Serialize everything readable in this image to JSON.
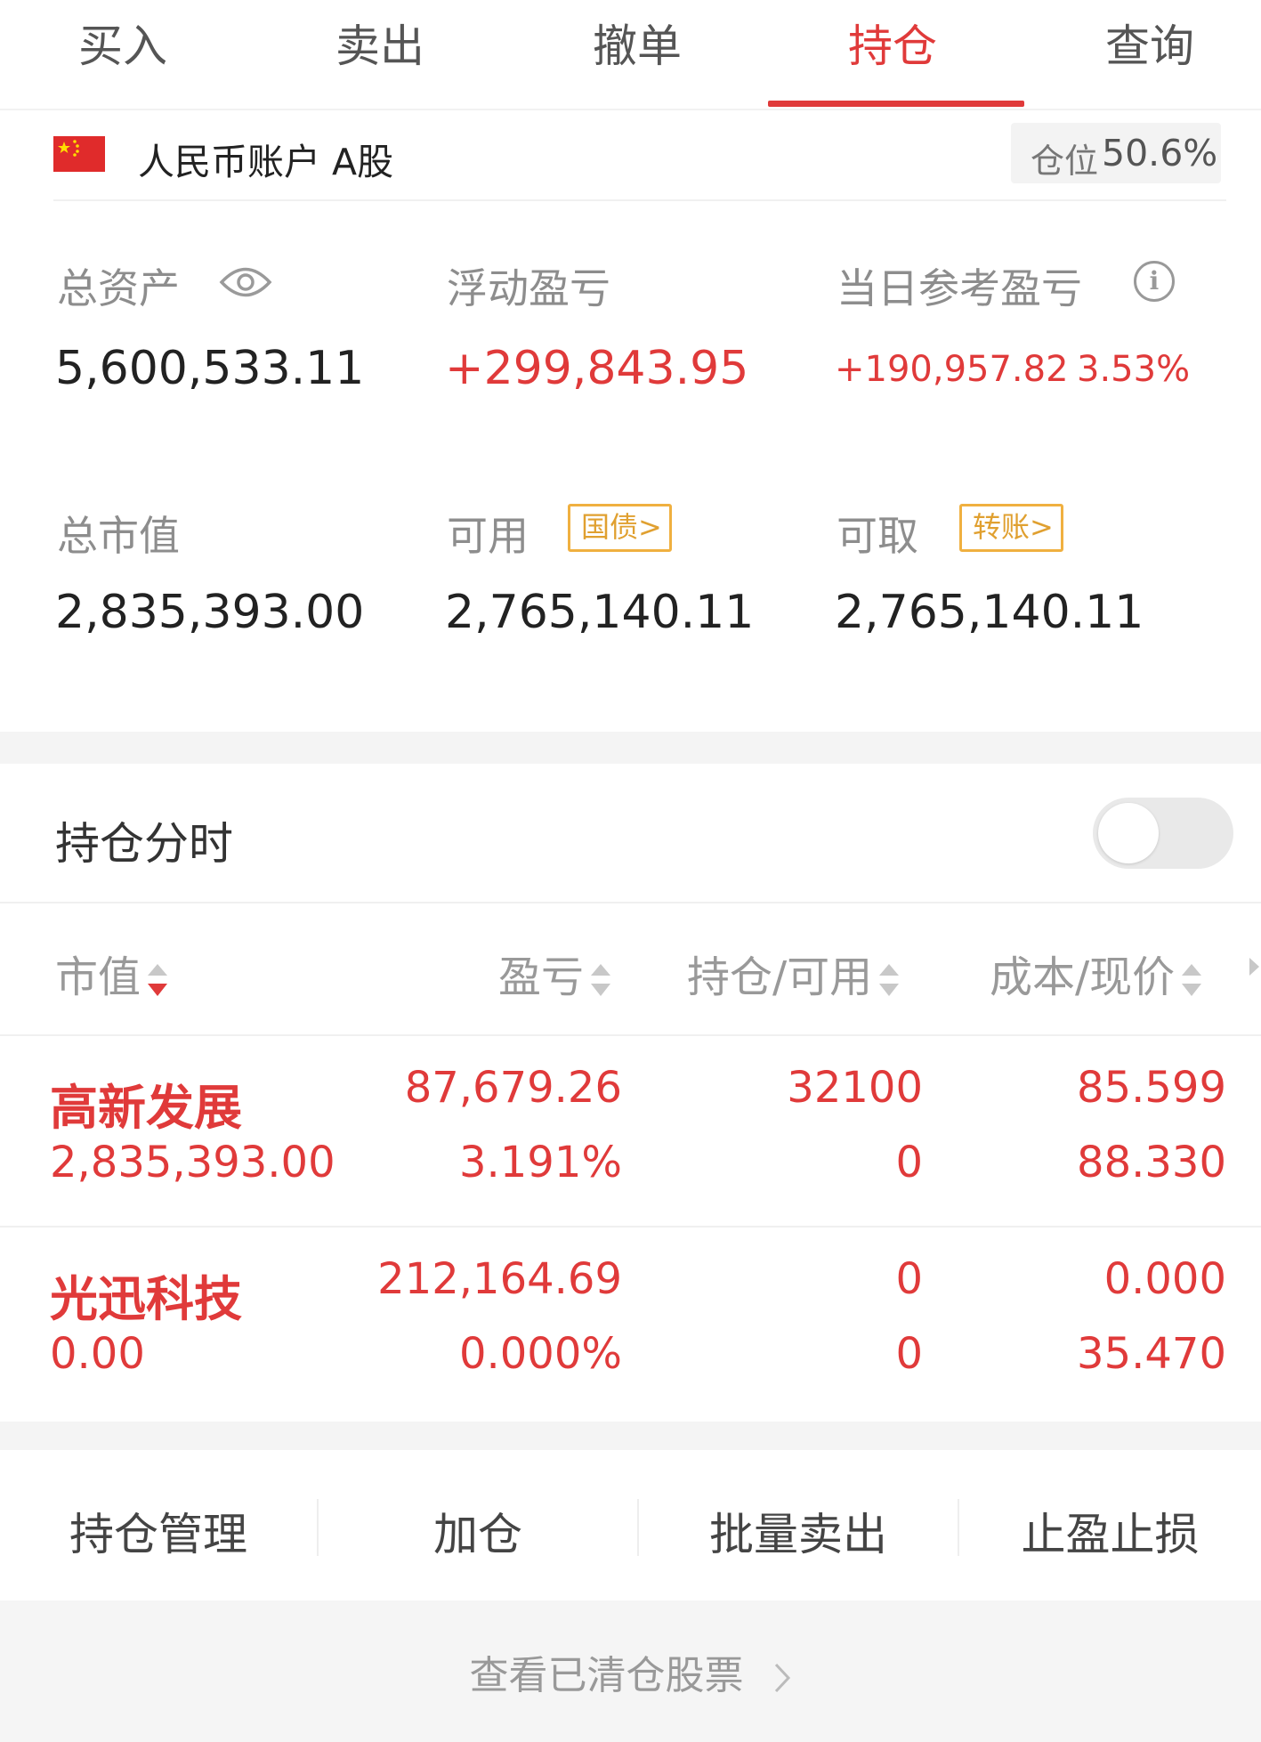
{
  "tabs": [
    {
      "label": "买入"
    },
    {
      "label": "卖出"
    },
    {
      "label": "撤单"
    },
    {
      "label": "持仓",
      "active": true
    },
    {
      "label": "查询"
    }
  ],
  "account": {
    "label": "人民币账户 A股",
    "position_label": "仓位",
    "position_value": "50.6%"
  },
  "summary": {
    "total_assets_label": "总资产",
    "total_assets": "5,600,533.11",
    "floating_pnl_label": "浮动盈亏",
    "floating_pnl": "+299,843.95",
    "daily_pnl_label": "当日参考盈亏",
    "daily_pnl": "+190,957.82",
    "daily_pnl_pct": "3.53%",
    "market_value_label": "总市值",
    "market_value": "2,835,393.00",
    "available_label": "可用",
    "available_tag": "国债>",
    "available": "2,765,140.11",
    "withdrawable_label": "可取",
    "withdrawable_tag": "转账>",
    "withdrawable": "2,765,140.11"
  },
  "timeshare": {
    "label": "持仓分时",
    "toggle_on": false
  },
  "table": {
    "headers": [
      "市值",
      "盈亏",
      "持仓/可用",
      "成本/现价"
    ],
    "rows": [
      {
        "name": "高新发展",
        "market_value": "2,835,393.00",
        "pnl": "87,679.26",
        "pnl_pct": "3.191%",
        "position": "32100",
        "available": "0",
        "cost": "85.599",
        "price": "88.330"
      },
      {
        "name": "光迅科技",
        "market_value": "0.00",
        "pnl": "212,164.69",
        "pnl_pct": "0.000%",
        "position": "0",
        "available": "0",
        "cost": "0.000",
        "price": "35.470"
      }
    ]
  },
  "actions": [
    "持仓管理",
    "加仓",
    "批量卖出",
    "止盈止损"
  ],
  "footer": {
    "link": "查看已清仓股票"
  },
  "colors": {
    "accent": "#e03a3a",
    "tag": "#f0b040"
  },
  "icons": [
    "eye-icon",
    "info-icon",
    "sort-icon",
    "chevron-right-icon",
    "flag-icon"
  ]
}
